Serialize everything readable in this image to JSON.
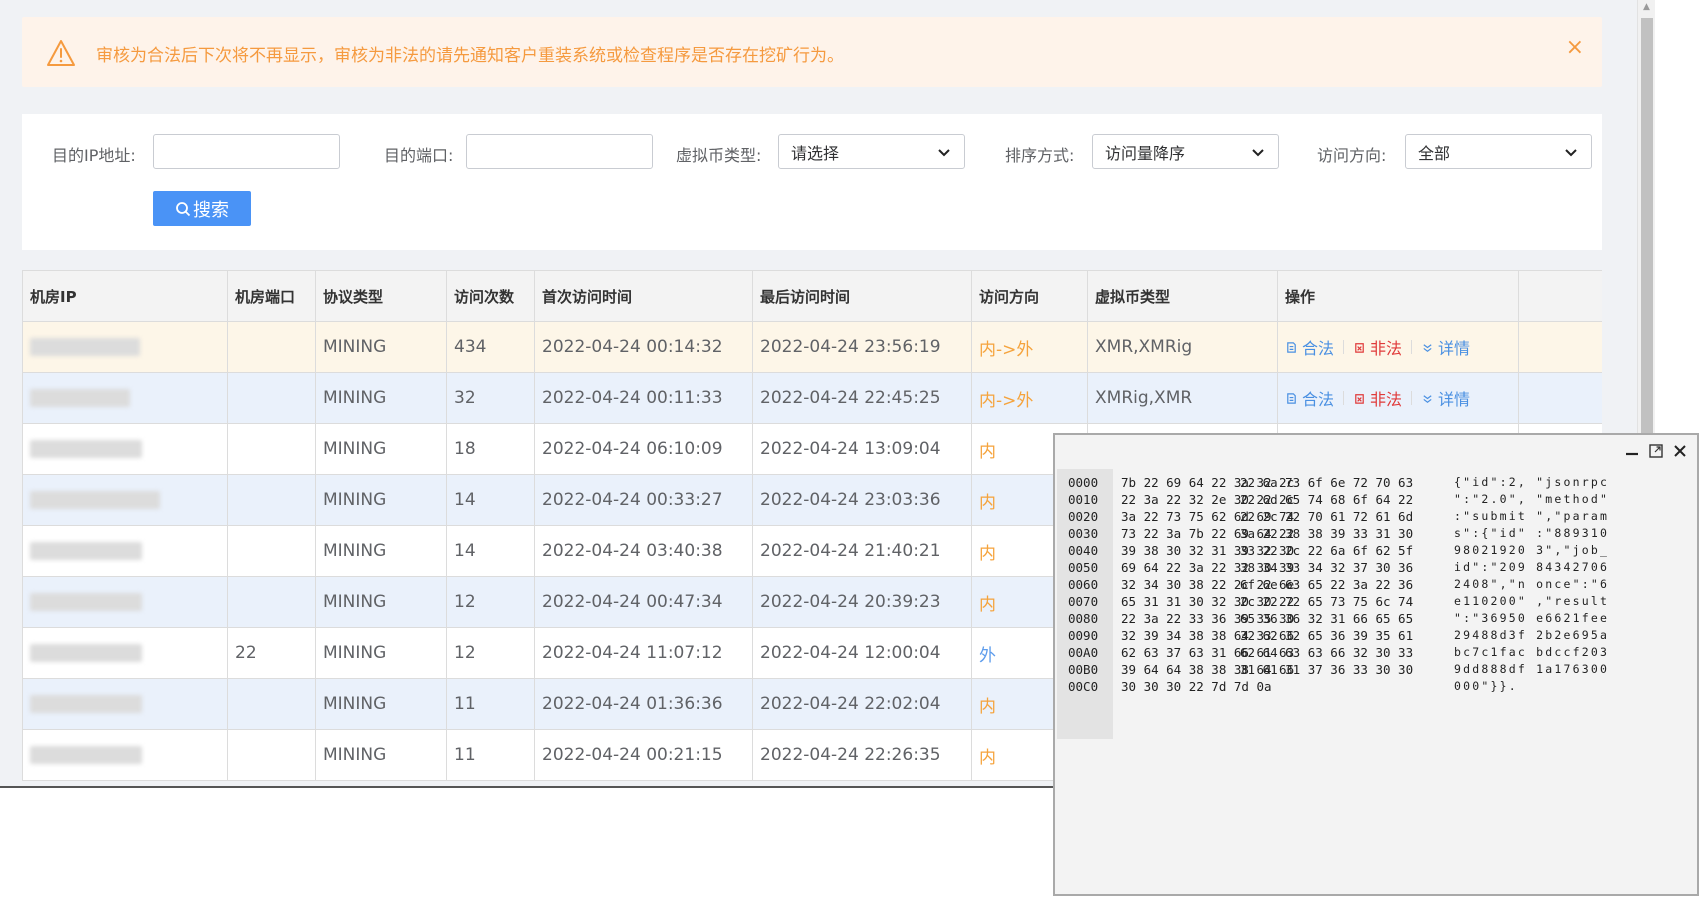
{
  "alert": {
    "message": "审核为合法后下次将不再显示，审核为非法的请先通知客户重装系统或检查程序是否存在挖矿行为。",
    "icon": "warning-triangle-icon",
    "close_symbol": "×",
    "color": "#f59a3f"
  },
  "search": {
    "dest_ip_label": "目的IP地址:",
    "dest_ip_value": "",
    "dest_port_label": "目的端口:",
    "dest_port_value": "",
    "coin_type_label": "虚拟币类型:",
    "coin_type_selected": "请选择",
    "sort_label": "排序方式:",
    "sort_selected": "访问量降序",
    "direction_label": "访问方向:",
    "direction_selected": "全部",
    "search_button": "搜索"
  },
  "table": {
    "headers": [
      "机房IP",
      "机房端口",
      "协议类型",
      "访问次数",
      "首次访问时间",
      "最后访问时间",
      "访问方向",
      "虚拟币类型",
      "操作"
    ],
    "rows": [
      {
        "port": "",
        "protocol": "MINING",
        "count": "434",
        "first": "2022-04-24 00:14:32",
        "last": "2022-04-24 23:56:19",
        "direction": "内->外",
        "coin": "XMR,XMRig"
      },
      {
        "port": "",
        "protocol": "MINING",
        "count": "32",
        "first": "2022-04-24 00:11:33",
        "last": "2022-04-24 22:45:25",
        "direction": "内->外",
        "coin": "XMRig,XMR"
      },
      {
        "port": "",
        "protocol": "MINING",
        "count": "18",
        "first": "2022-04-24 06:10:09",
        "last": "2022-04-24 13:09:04",
        "direction": "内",
        "coin": ""
      },
      {
        "port": "",
        "protocol": "MINING",
        "count": "14",
        "first": "2022-04-24 00:33:27",
        "last": "2022-04-24 23:03:36",
        "direction": "内",
        "coin": ""
      },
      {
        "port": "",
        "protocol": "MINING",
        "count": "14",
        "first": "2022-04-24 03:40:38",
        "last": "2022-04-24 21:40:21",
        "direction": "内",
        "coin": ""
      },
      {
        "port": "",
        "protocol": "MINING",
        "count": "12",
        "first": "2022-04-24 00:47:34",
        "last": "2022-04-24 20:39:23",
        "direction": "内",
        "coin": ""
      },
      {
        "port": "22",
        "protocol": "MINING",
        "count": "12",
        "first": "2022-04-24 11:07:12",
        "last": "2022-04-24 12:00:04",
        "direction": "外",
        "coin": ""
      },
      {
        "port": "",
        "protocol": "MINING",
        "count": "11",
        "first": "2022-04-24 01:36:36",
        "last": "2022-04-24 22:02:04",
        "direction": "内",
        "coin": ""
      },
      {
        "port": "",
        "protocol": "MINING",
        "count": "11",
        "first": "2022-04-24 00:21:15",
        "last": "2022-04-24 22:26:35",
        "direction": "内",
        "coin": ""
      }
    ],
    "ops": {
      "legal": "合法",
      "illegal": "非法",
      "detail": "详情"
    }
  },
  "hex": {
    "lines": [
      {
        "off": "0000",
        "a": "7b 22 69 64 22 3a 32 2c",
        "b": "22 6a 73 6f 6e 72 70 63",
        "ascii": "{\"id\":2, \"jsonrpc"
      },
      {
        "off": "0010",
        "a": "22 3a 22 32 2e 30 22 2c",
        "b": "22 6d 65 74 68 6f 64 22",
        "ascii": "\":\"2.0\", \"method\""
      },
      {
        "off": "0020",
        "a": "3a 22 73 75 62 6d 69 74",
        "b": "22 2c 22 70 61 72 61 6d",
        "ascii": ":\"submit \",\"param"
      },
      {
        "off": "0030",
        "a": "73 22 3a 7b 22 69 64 22",
        "b": "3a 22 38 38 39 33 31 30",
        "ascii": "s\":{\"id\" :\"889310"
      },
      {
        "off": "0040",
        "a": "39 38 30 32 31 39 32 30",
        "b": "33 22 2c 22 6a 6f 62 5f",
        "ascii": "98021920 3\",\"job_"
      },
      {
        "off": "0050",
        "a": "69 64 22 3a 22 32 30 39",
        "b": "38 34 33 34 32 37 30 36",
        "ascii": "id\":\"209 84342706"
      },
      {
        "off": "0060",
        "a": "32 34 30 38 22 2c 22 6e",
        "b": "6f 6e 63 65 22 3a 22 36",
        "ascii": "2408\",\"n once\":\"6"
      },
      {
        "off": "0070",
        "a": "65 31 31 30 32 30 30 22",
        "b": "2c 22 72 65 73 75 6c 74",
        "ascii": "e110200\" ,\"result"
      },
      {
        "off": "0080",
        "a": "22 3a 22 33 36 39 35 30",
        "b": "65 36 36 32 31 66 65 65",
        "ascii": "\":\"36950 e6621fee"
      },
      {
        "off": "0090",
        "a": "32 39 34 38 38 64 33 66",
        "b": "32 62 32 65 36 39 35 61",
        "ascii": "29488d3f 2b2e695a"
      },
      {
        "off": "00A0",
        "a": "62 63 37 63 31 66 61 63",
        "b": "62 64 63 63 66 32 30 33",
        "ascii": "bc7c1fac bdccf203"
      },
      {
        "off": "00B0",
        "a": "39 64 64 38 38 38 64 66",
        "b": "31 61 31 37 36 33 30 30",
        "ascii": "9dd888df 1a176300"
      },
      {
        "off": "00C0",
        "a": "30 30 30 22 7d 7d 0a",
        "b": "",
        "ascii": "000\"}}."
      }
    ]
  },
  "colors": {
    "accent": "#4a93f6",
    "warning": "#f59a3f",
    "danger": "#e03a3a",
    "row_highlight": "#fdf6e8",
    "row_alt": "#eaf1fb"
  }
}
